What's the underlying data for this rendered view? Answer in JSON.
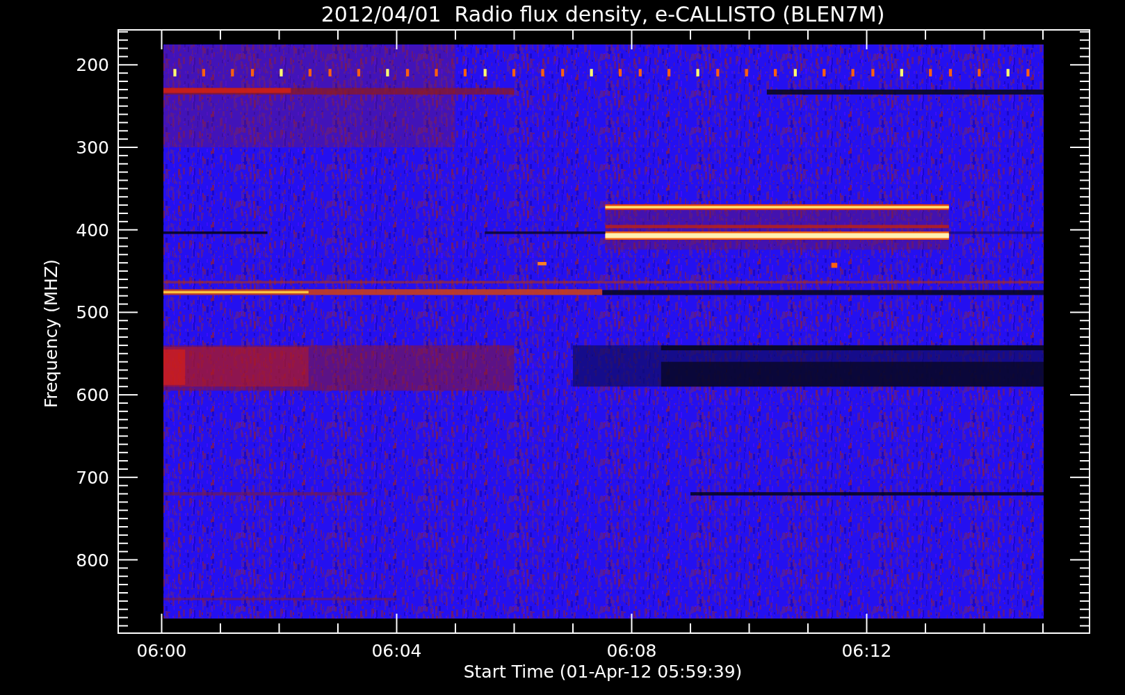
{
  "plot": {
    "title": "2012/04/01  Radio flux density, e-CALLISTO (BLEN7M)",
    "ylabel": "Frequency (MHZ)",
    "xlabel": "Start Time (01-Apr-12 05:59:39)",
    "yticks": [
      "200",
      "300",
      "400",
      "500",
      "600",
      "700",
      "800"
    ],
    "xticks": [
      "06:00",
      "06:04",
      "06:08",
      "06:12"
    ]
  }
}
